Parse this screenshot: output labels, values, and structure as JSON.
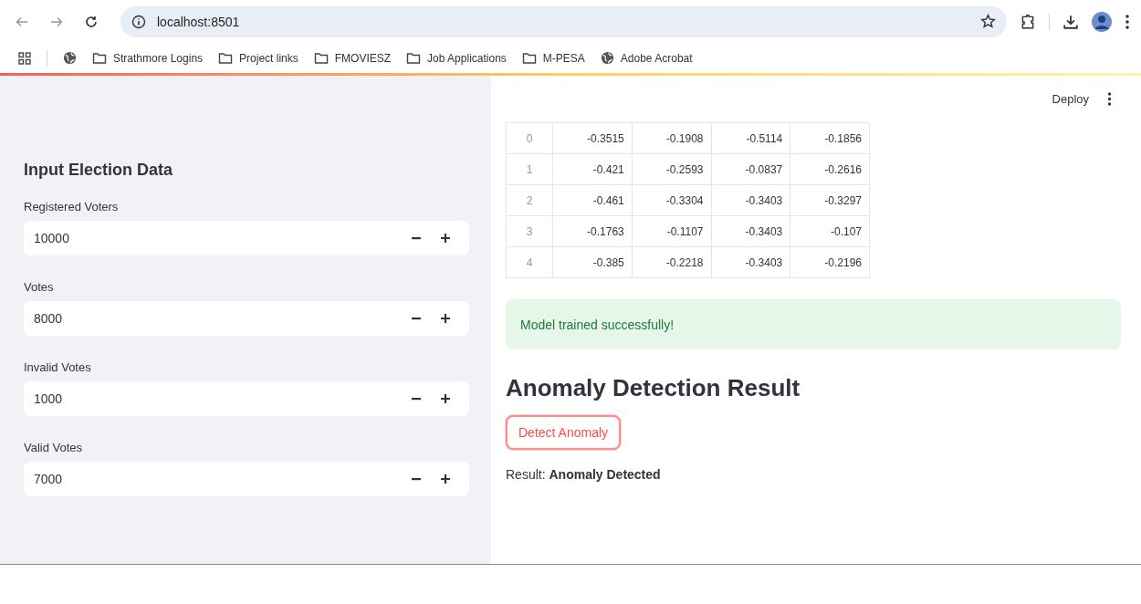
{
  "browser": {
    "address": "localhost:8501",
    "bookmarks": [
      {
        "label": "Strathmore Logins",
        "kind": "folder"
      },
      {
        "label": "Project links",
        "kind": "folder"
      },
      {
        "label": "FMOVIESZ",
        "kind": "folder"
      },
      {
        "label": "Job Applications",
        "kind": "folder"
      },
      {
        "label": "M-PESA",
        "kind": "folder"
      },
      {
        "label": "Adobe Acrobat",
        "kind": "globe"
      }
    ]
  },
  "header": {
    "deploy": "Deploy"
  },
  "sidebar": {
    "title": "Input Election Data",
    "fields": [
      {
        "label": "Registered Voters",
        "value": "10000"
      },
      {
        "label": "Votes",
        "value": "8000"
      },
      {
        "label": "Invalid Votes",
        "value": "1000"
      },
      {
        "label": "Valid Votes",
        "value": "7000"
      }
    ]
  },
  "table": {
    "rows": [
      {
        "index": "0",
        "cells": [
          "-0.3515",
          "-0.1908",
          "-0.5114",
          "-0.1856"
        ]
      },
      {
        "index": "1",
        "cells": [
          "-0.421",
          "-0.2593",
          "-0.0837",
          "-0.2616"
        ]
      },
      {
        "index": "2",
        "cells": [
          "-0.461",
          "-0.3304",
          "-0.3403",
          "-0.3297"
        ]
      },
      {
        "index": "3",
        "cells": [
          "-0.1763",
          "-0.1107",
          "-0.3403",
          "-0.107"
        ]
      },
      {
        "index": "4",
        "cells": [
          "-0.385",
          "-0.2218",
          "-0.3403",
          "-0.2196"
        ]
      }
    ]
  },
  "success_message": "Model trained successfully!",
  "heading": "Anomaly Detection Result",
  "button": "Detect Anomaly",
  "result": "Result: **Anomaly Detected**"
}
